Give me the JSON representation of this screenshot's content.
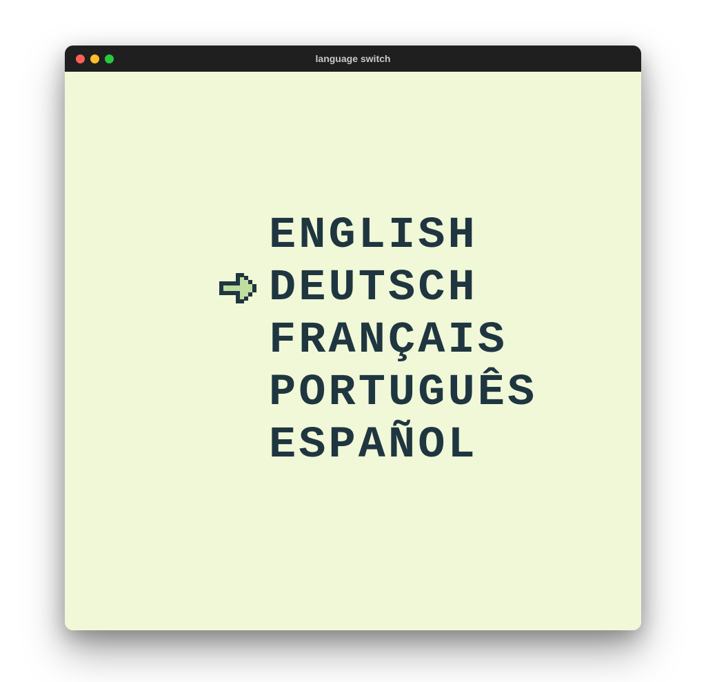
{
  "window": {
    "title": "language switch"
  },
  "colors": {
    "background": "#f0f8d8",
    "text": "#1f3640",
    "arrow_fill": "#c0dca0"
  },
  "menu": {
    "selected_index": 1,
    "items": [
      {
        "label": "ENGLISH",
        "name": "language-option-english"
      },
      {
        "label": "DEUTSCH",
        "name": "language-option-deutsch"
      },
      {
        "label": "FRANÇAIS",
        "name": "language-option-francais"
      },
      {
        "label": "PORTUGUÊS",
        "name": "language-option-portugues"
      },
      {
        "label": "ESPAÑOL",
        "name": "language-option-espanol"
      }
    ]
  }
}
